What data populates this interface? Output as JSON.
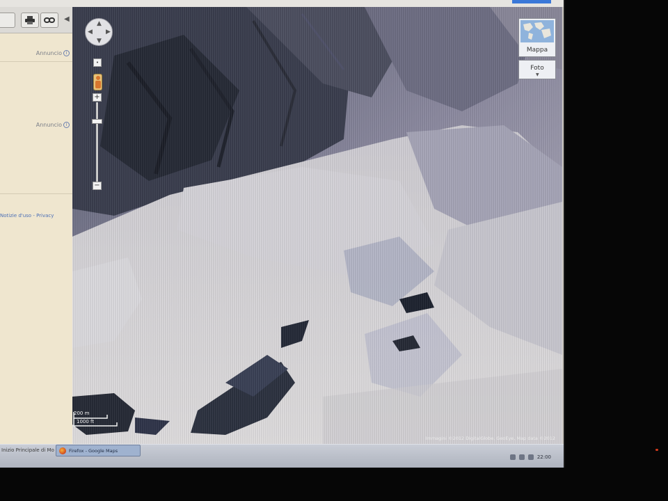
{
  "sidepanel": {
    "ad_label_1": "Annuncio",
    "ad_label_2": "Annuncio",
    "footer_links": "Notizie d'uso - Privacy",
    "info_glyph": "i"
  },
  "toolbar": {
    "print_icon": "print-icon",
    "link_icon": "link-icon",
    "collapse_glyph": "◀"
  },
  "map": {
    "maptype_map_label": "Mappa",
    "maptype_photo_label": "Foto",
    "scale_top": "200 m",
    "scale_bottom": "1000 ft",
    "copyright": "Immagini ©2012 DigitalGlobe, GeoEye, Map data ©2012",
    "zoom_in": "+",
    "zoom_out": "−",
    "reset": "•",
    "colors": {
      "snow": "#d8d6da",
      "rock": "#2e3340",
      "shadow": "#474b5e"
    }
  },
  "taskbar": {
    "left_label": "Inizio Principale di Mozil",
    "firefox_label": "Firefox - Google Maps",
    "clock": "22:00"
  }
}
